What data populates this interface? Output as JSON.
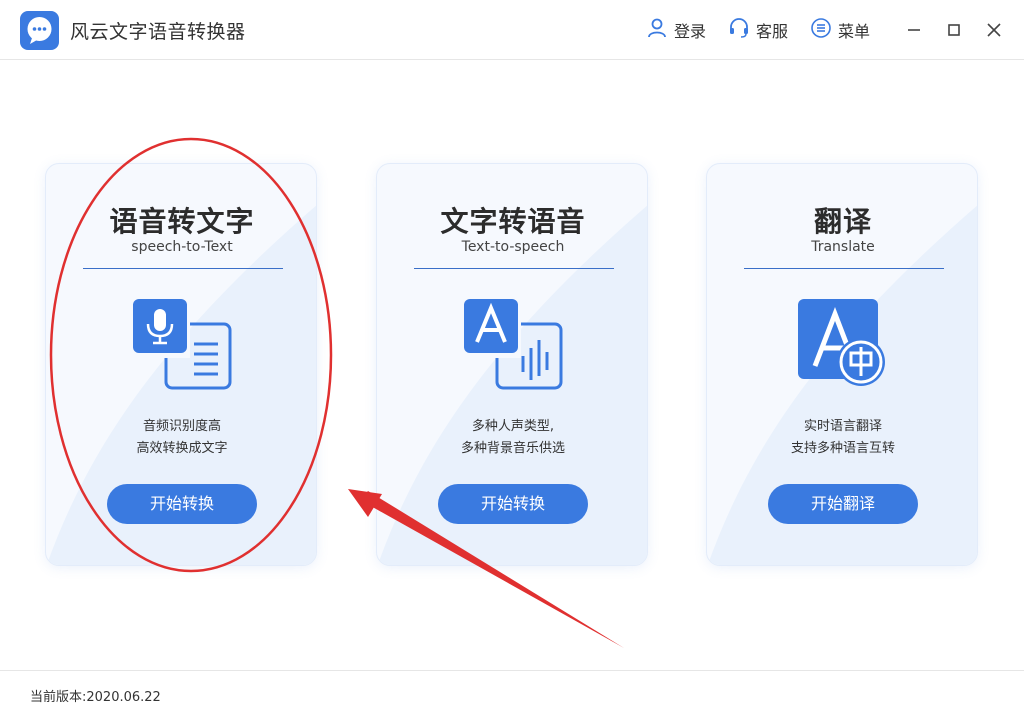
{
  "window": {
    "title": "风云文字语音转换器",
    "header_buttons": [
      {
        "label": "登录",
        "icon": "user-icon"
      },
      {
        "label": "客服",
        "icon": "headset-icon"
      },
      {
        "label": "菜单",
        "icon": "menu-icon"
      }
    ]
  },
  "cards": [
    {
      "title": "语音转文字",
      "subtitle": "speech-to-Text",
      "icon": "speech-to-text-icon",
      "desc_line1": "音频识别度高",
      "desc_line2": "高效转换成文字",
      "button": "开始转换"
    },
    {
      "title": "文字转语音",
      "subtitle": "Text-to-speech",
      "icon": "text-to-speech-icon",
      "desc_line1": "多种人声类型,",
      "desc_line2": "多种背景音乐供选",
      "button": "开始转换"
    },
    {
      "title": "翻译",
      "subtitle": "Translate",
      "icon": "translate-icon",
      "desc_line1": "实时语言翻译",
      "desc_line2": "支持多种语言互转",
      "button": "开始翻译"
    }
  ],
  "status": {
    "version": "当前版本:2020.06.22"
  },
  "colors": {
    "accent": "#3a7ae0",
    "annotation": "#e03030"
  }
}
